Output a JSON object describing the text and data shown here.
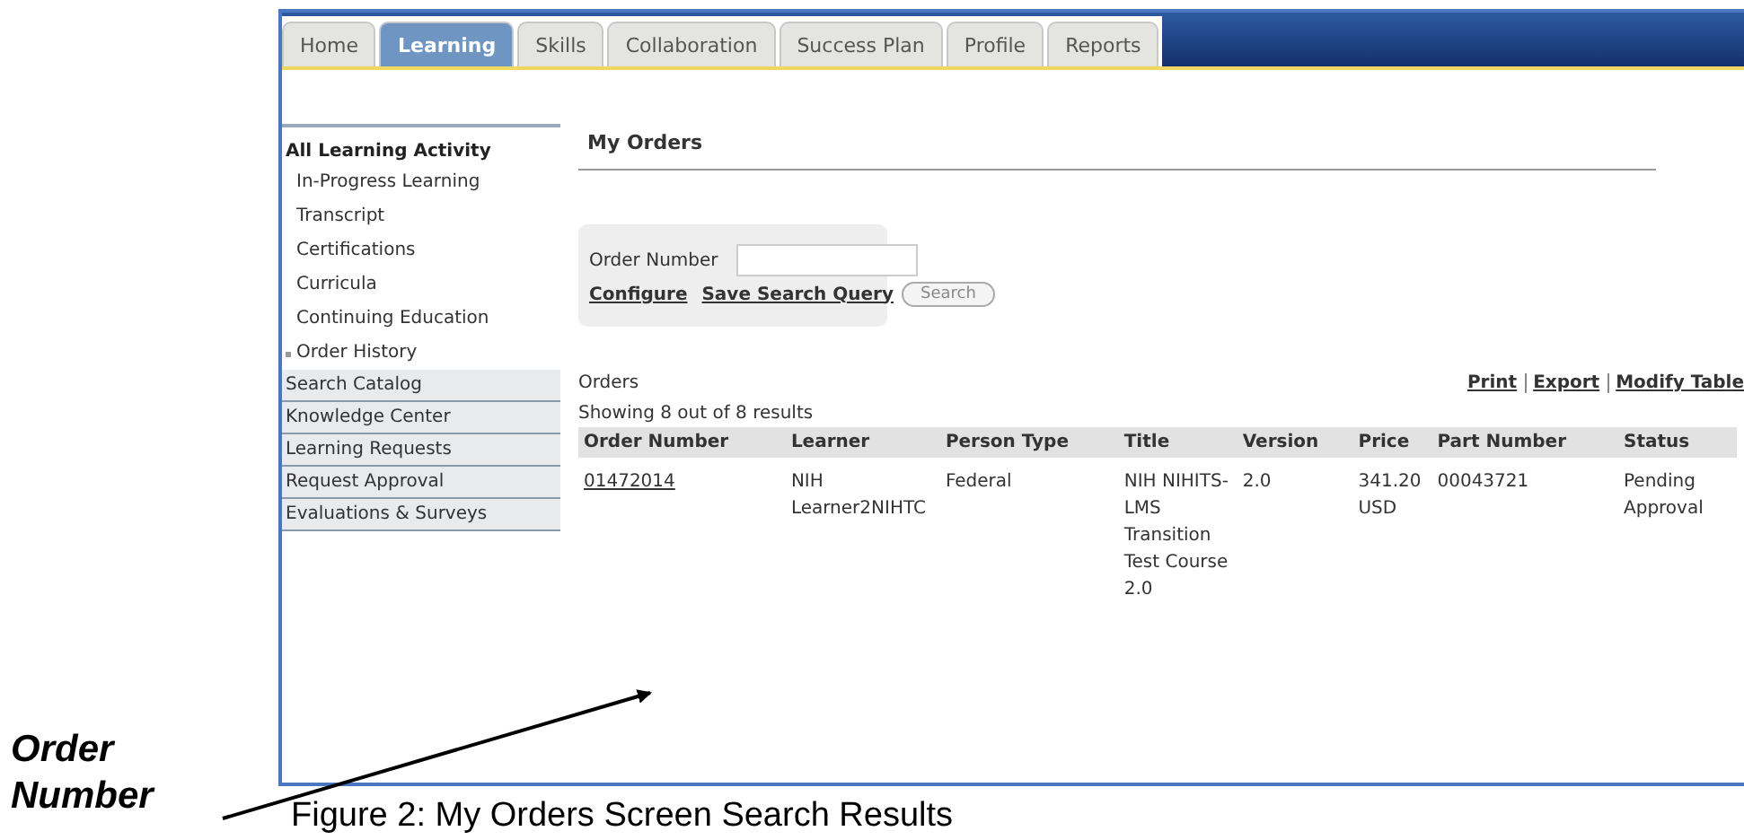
{
  "tabs": [
    {
      "label": "Home",
      "selected": false
    },
    {
      "label": "Learning",
      "selected": true
    },
    {
      "label": "Skills",
      "selected": false
    },
    {
      "label": "Collaboration",
      "selected": false
    },
    {
      "label": "Success Plan",
      "selected": false
    },
    {
      "label": "Profile",
      "selected": false
    },
    {
      "label": "Reports",
      "selected": false
    }
  ],
  "sidebar": {
    "heading": "All Learning Activity",
    "subitems": [
      {
        "label": "In-Progress Learning",
        "selected": false
      },
      {
        "label": "Transcript",
        "selected": false
      },
      {
        "label": "Certifications",
        "selected": false
      },
      {
        "label": "Curricula",
        "selected": false
      },
      {
        "label": "Continuing Education",
        "selected": false
      },
      {
        "label": "Order History",
        "selected": true
      }
    ],
    "sections": [
      "Search Catalog",
      "Knowledge Center",
      "Learning Requests",
      "Request Approval",
      "Evaluations & Surveys"
    ]
  },
  "page_title": "My Orders",
  "search": {
    "label": "Order Number",
    "links": [
      "Configure",
      "Save Search Query"
    ],
    "button": "Search"
  },
  "orders": {
    "title": "Orders",
    "actions": [
      "Print",
      "Export",
      "Modify Table"
    ],
    "summary": "Showing 8 out of 8 results",
    "columns": [
      "Order Number",
      "Learner",
      "Person Type",
      "Title",
      "Version",
      "Price",
      "Part Number",
      "Status"
    ],
    "rows": [
      [
        "01472014",
        "NIH Learner2NIHTC",
        "Federal",
        "NIH NIHITS-LMS Transition Test Course 2.0",
        "2.0",
        "341.20 USD",
        "00043721",
        "Pending Approval"
      ]
    ]
  },
  "annotation": "Order Number",
  "caption": "Figure 2: My Orders Screen Search Results"
}
